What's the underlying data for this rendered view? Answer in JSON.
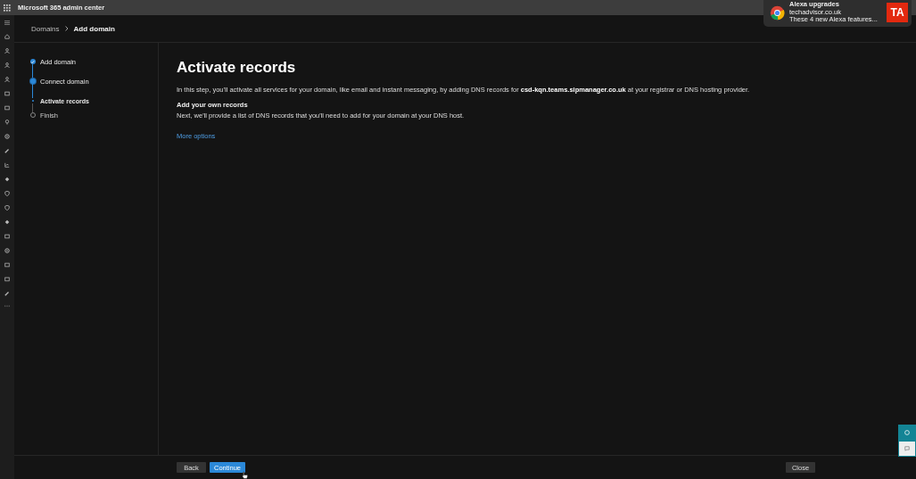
{
  "app_bar": {
    "title": "Microsoft 365 admin center"
  },
  "breadcrumb": [
    "Domains",
    "Add domain"
  ],
  "steps": [
    {
      "label": "Add domain",
      "kind": "step",
      "completed": true,
      "current": false
    },
    {
      "label": "Connect domain",
      "kind": "step",
      "completed": false,
      "current": true
    },
    {
      "label": "Activate records",
      "kind": "substep",
      "completed": false,
      "current": true
    },
    {
      "label": "Finish",
      "kind": "step",
      "completed": false,
      "current": false
    }
  ],
  "content": {
    "heading": "Activate records",
    "intro": "In this step, you'll activate all services for your domain, like email and instant messaging, by adding DNS records for **csd-kqn.teams.sipmanager.co.uk** at your registrar or DNS hosting provider.",
    "section_title": "Add your own records",
    "section_text": "Next, we'll provide a list of DNS records that you'll need to add for your domain at your DNS host.",
    "link": "More options"
  },
  "footer": {
    "back": "Back",
    "continue": "Continue",
    "close": "Close"
  },
  "notification": {
    "title": "Alexa upgrades",
    "source": "techadvisor.co.uk",
    "message": "These 4 new Alexa features...",
    "logo_text": "TA"
  }
}
